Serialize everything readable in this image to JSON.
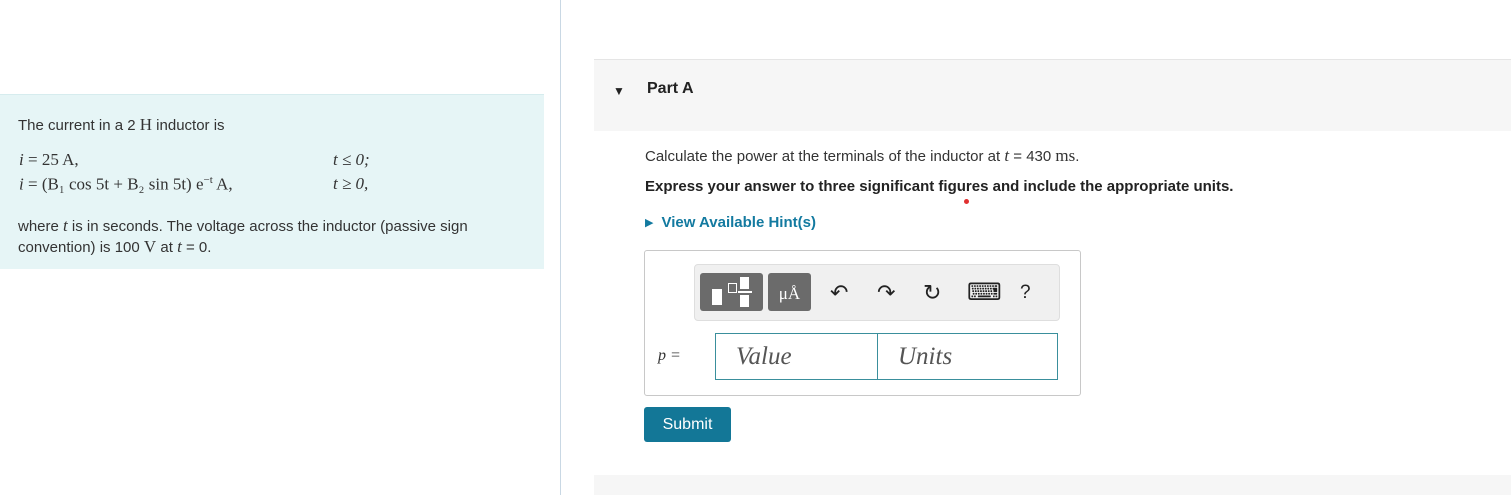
{
  "problem": {
    "intro_prefix": "The current in a 2 ",
    "intro_unit": "H",
    "intro_suffix": " inductor is",
    "eq1_lhs": "i",
    "eq1_rhs": " = 25 A,",
    "eq1_cond": "t ≤ 0;",
    "eq2_lhs": "i",
    "eq2_rhs": " = (B₁  cos 5t + B₂ sin 5t) e",
    "eq2_sup": "−t",
    "eq2_tail": " A,",
    "eq2_cond": "t ≥ 0,",
    "tail_1": "where ",
    "tail_var": "t",
    "tail_2": " is in seconds. The voltage across the inductor (passive sign convention) is 100 ",
    "tail_unit": "V",
    "tail_3": " at ",
    "tail_var2": "t",
    "tail_4": " = 0."
  },
  "part": {
    "toggle_icon": "▼",
    "title": "Part A"
  },
  "question": {
    "prefix": "Calculate the power at the terminals of the inductor at ",
    "var": "t",
    "value": " = 430 ",
    "unit": "ms",
    "suffix": "."
  },
  "instruction": "Express your answer to three significant figures and include the appropriate units.",
  "hints": {
    "arrow": "▶",
    "label": "View Available Hint(s)"
  },
  "toolbar": {
    "units_label": "μÅ",
    "undo": "↶",
    "redo": "↷",
    "reset": "↻",
    "keyboard": "⌨",
    "help": "?"
  },
  "answer": {
    "label": "p =",
    "value_placeholder": "Value",
    "units_placeholder": "Units"
  },
  "submit_label": "Submit",
  "colors": {
    "problem_bg": "#e6f5f6",
    "accent": "#137797",
    "link": "#137aa0"
  }
}
